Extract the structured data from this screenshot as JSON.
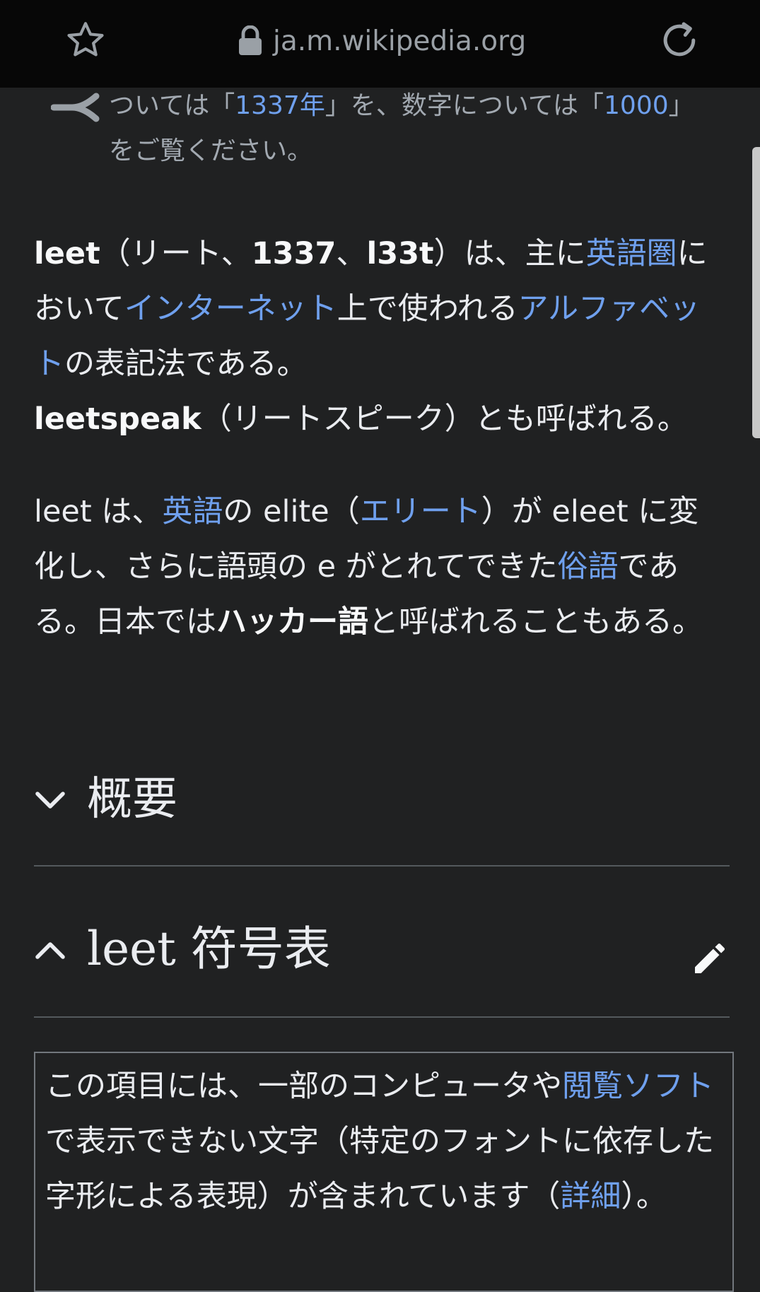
{
  "browser": {
    "url": "ja.m.wikipedia.org",
    "icons": [
      "star-icon",
      "lock-icon",
      "reload-icon"
    ]
  },
  "hatnote": {
    "p1": "ついては「",
    "link1": "1337年",
    "p2": "」を、数字については「",
    "link2": "1000",
    "p3": "」",
    "p4": "をご覧ください。"
  },
  "intro": {
    "b1": "leet",
    "t1": "（リート、",
    "b2": "1337",
    "t2": "、",
    "b3": "l33t",
    "t3": "）は、主に",
    "l1": "英語圏",
    "t4": "において",
    "l2": "インターネット",
    "t5": "上で使われる",
    "l3": "アルファベット",
    "t6": "の表記法である。",
    "b4": "leetspeak",
    "t7": "（リートスピーク）とも呼ばれる。"
  },
  "para2": {
    "t1": "leet は、",
    "l1": "英語",
    "t2": "の elite（",
    "l2": "エリート",
    "t3": "）が eleet に変化し、さらに語頭の e がとれてできた",
    "l3": "俗語",
    "t4": "である。日本では",
    "b1": "ハッカー語",
    "t5": "と呼ばれることもある。"
  },
  "sections": {
    "overview": "概要",
    "table": "leet 符号表"
  },
  "ambox": {
    "t1": "この項目には、一部のコンピュータや",
    "l1": "閲覧ソフト",
    "t2": "で表示できない文字（特定のフォントに依存した字形による表現）が含まれています（",
    "l2": "詳細",
    "t3": "）。"
  },
  "colors": {
    "background": "#202122",
    "link": "#6fa0ee",
    "text": "#eaecf0",
    "toolbar": "#070707"
  }
}
